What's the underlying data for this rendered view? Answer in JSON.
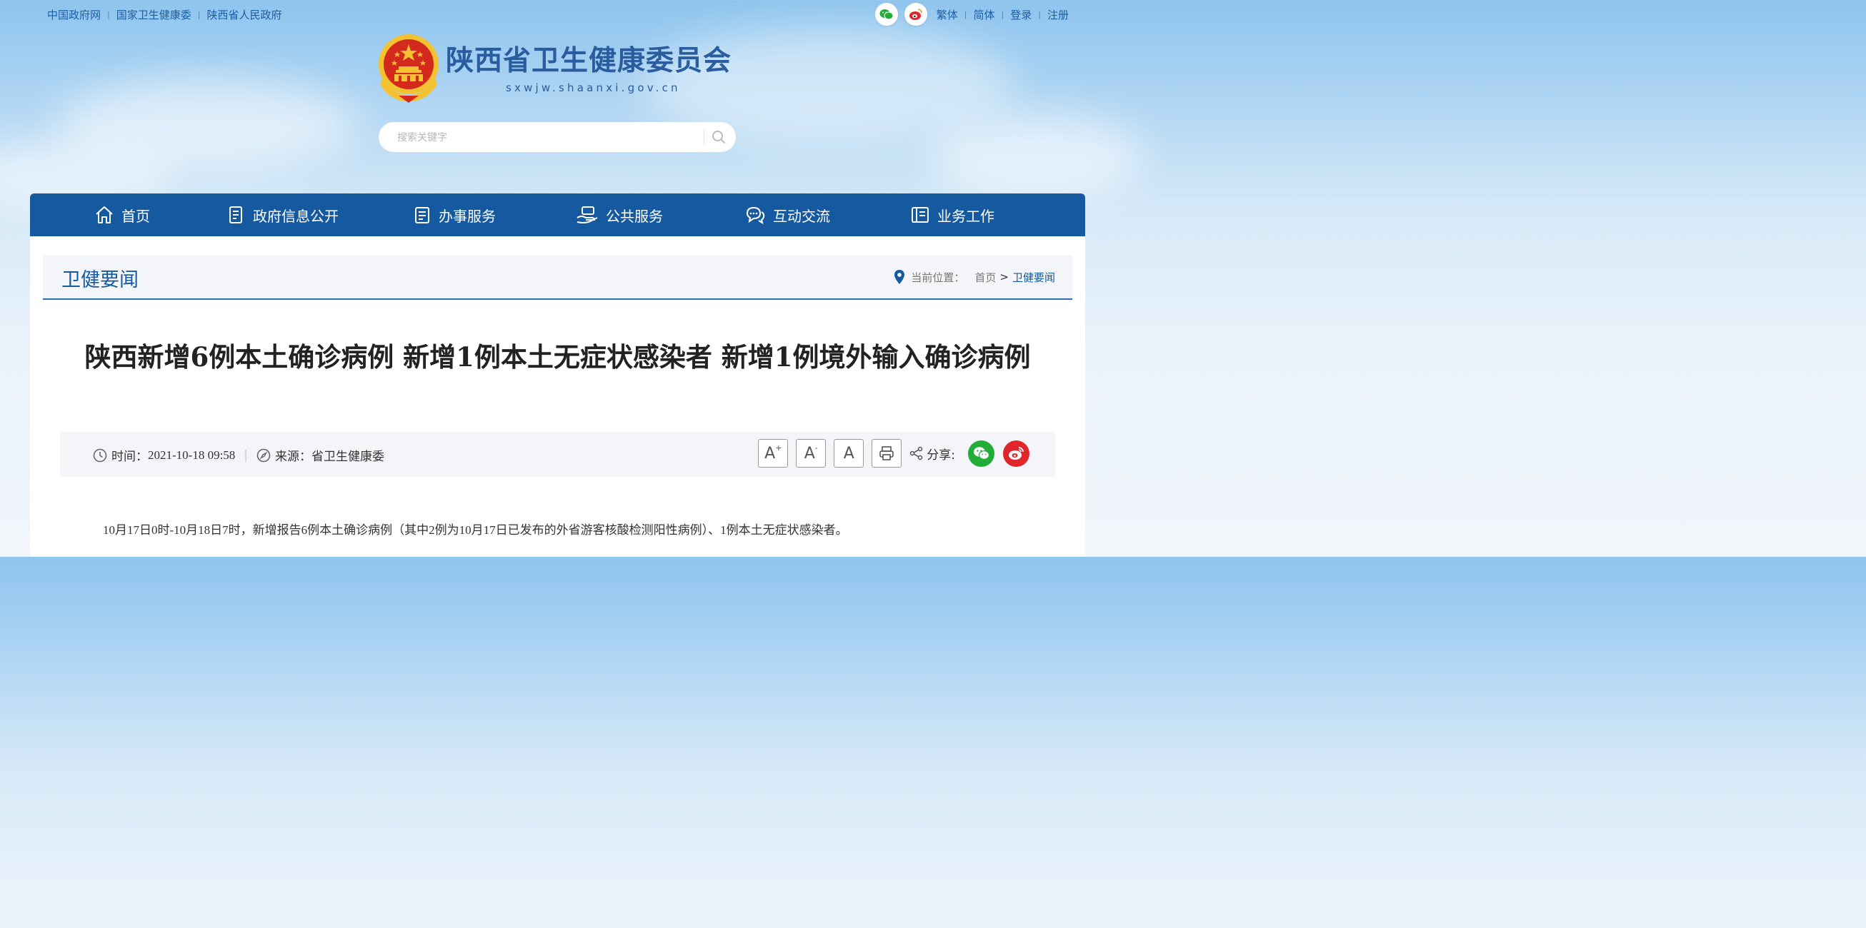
{
  "top_links": [
    "中国政府网",
    "国家卫生健康委",
    "陕西省人民政府"
  ],
  "top_right_links": [
    "繁体",
    "简体",
    "登录",
    "注册"
  ],
  "site": {
    "title": "陕西省卫生健康委员会",
    "domain": "sxwjw.shaanxi.gov.cn"
  },
  "search": {
    "placeholder": "搜索关键字"
  },
  "nav": [
    "首页",
    "政府信息公开",
    "办事服务",
    "公共服务",
    "互动交流",
    "业务工作"
  ],
  "section": {
    "title": "卫健要闻"
  },
  "breadcrumb": {
    "label": "当前位置：",
    "home": "首页",
    "separator": ">",
    "current": "卫健要闻"
  },
  "article": {
    "title": "陕西新增6例本土确诊病例 新增1例本土无症状感染者 新增1例境外输入确诊病例",
    "time_label": "时间：",
    "time_value": "2021-10-18 09:58",
    "source_label": "来源：",
    "source_value": "省卫生健康委",
    "font_buttons": [
      "A",
      "A",
      "A"
    ],
    "font_up_mark": "+",
    "font_down_mark": "-",
    "share_label": "分享:",
    "body_first_line": "10月17日0时-10月18日7时，新增报告6例本土确诊病例（其中2例为10月17日已发布的外省游客核酸检测阳性病例）、1例本土无症状感染者。"
  },
  "icons": {
    "top_share": [
      "wechat-icon",
      "weibo-icon"
    ],
    "nav": [
      "home-icon",
      "document-icon",
      "clipboard-icon",
      "hand-service-icon",
      "chat-icon",
      "briefcase-icon"
    ],
    "meta": [
      "clock-icon",
      "compass-icon",
      "print-icon",
      "share-icon"
    ]
  },
  "colors": {
    "brand_blue": "#155aa0",
    "wechat_green": "#22ac38",
    "weibo_red": "#e0262b",
    "emblem_red": "#d42a1e",
    "emblem_gold": "#f2c230"
  }
}
